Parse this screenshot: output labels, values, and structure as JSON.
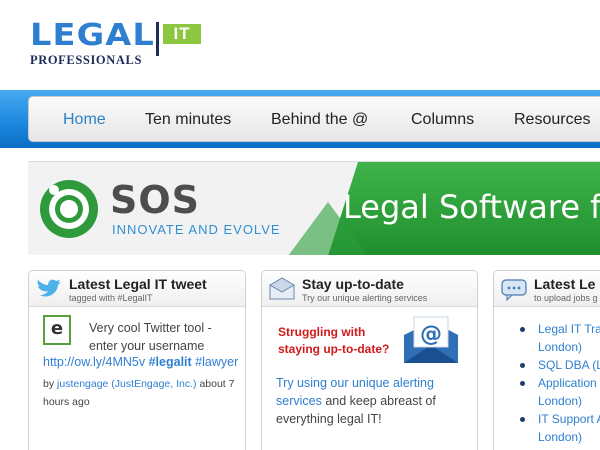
{
  "logo": {
    "word1": "LEGAL",
    "word2": "IT",
    "word3": "PROFESSIONALS"
  },
  "nav": {
    "items": [
      "Home",
      "Ten minutes",
      "Behind the @",
      "Columns",
      "Resources"
    ],
    "active": "Home",
    "active_color": "#2c82c9"
  },
  "banner": {
    "brand": "SOS",
    "tagline": "INNOVATE AND EVOLVE",
    "headline": "Legal Software fo",
    "green": "#2ea53c"
  },
  "panels": {
    "tweet": {
      "title": "Latest Legal IT tweet",
      "subtitle": "tagged with #LegalIT",
      "icon": "twitter-bird-icon",
      "avatar_letter": "e",
      "text": "Very cool Twitter tool - enter your username",
      "link": "http://ow.ly/4MN5v",
      "hashtag1": "#legalit",
      "hashtag2": "#lawyer",
      "by": "by",
      "user": "justengage (JustEngage, Inc.)",
      "about": "about",
      "time": "7 hours ago"
    },
    "alerts": {
      "title": "Stay up-to-date",
      "subtitle": "Try our unique alerting services",
      "icon": "envelope-icon",
      "red_text": "Struggling with staying up-to-date?",
      "link_text": "Try using our unique alerting services",
      "rest": "and keep abreast of everything legal IT!"
    },
    "jobs": {
      "title": "Latest Le",
      "subtitle": "to upload jobs g",
      "icon": "speech-bubble-icon",
      "items": [
        {
          "line1": "Legal IT Tra",
          "line2": "London)"
        },
        {
          "line1": "SQL DBA (L",
          "line2": ""
        },
        {
          "line1": "Application",
          "line2": "London)"
        },
        {
          "line1": "IT Support A",
          "line2": "London)"
        }
      ]
    }
  }
}
